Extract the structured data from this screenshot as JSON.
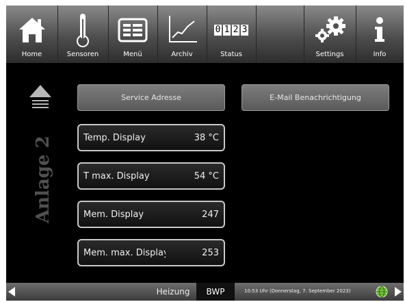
{
  "toolbar": {
    "items": [
      {
        "label": "Home",
        "icon": "home-icon"
      },
      {
        "label": "Sensoren",
        "icon": "thermometer-icon"
      },
      {
        "label": "Menü",
        "icon": "menu-list-icon"
      },
      {
        "label": "Archiv",
        "icon": "chart-line-icon"
      },
      {
        "label": "Status",
        "icon": "counter-icon",
        "counter_digits": [
          "0",
          "1",
          "2",
          "3"
        ]
      },
      {
        "label": "",
        "icon": ""
      },
      {
        "label": "Settings",
        "icon": "gears-icon"
      },
      {
        "label": "Info",
        "icon": "info-icon"
      }
    ]
  },
  "sidebar": {
    "up_icon": "up-arrow-icon",
    "anlage_label": "Anlage 2"
  },
  "main": {
    "service_button": "Service Adresse",
    "email_button": "E-Mail Benachrichtigung",
    "fields": [
      {
        "name": "Temp. Display",
        "value": "38 °C"
      },
      {
        "name": "T max. Display",
        "value": "54 °C"
      },
      {
        "name": "Mem. Display",
        "value": "247"
      },
      {
        "name": "Mem. max. Display",
        "value": "253"
      }
    ]
  },
  "bottombar": {
    "tab_heizung": "Heizung",
    "tab_bwp": "BWP",
    "datetime": "10:53 Uhr (Donnerstag, 7. September 2023)",
    "globe_color": "#7ac943"
  }
}
